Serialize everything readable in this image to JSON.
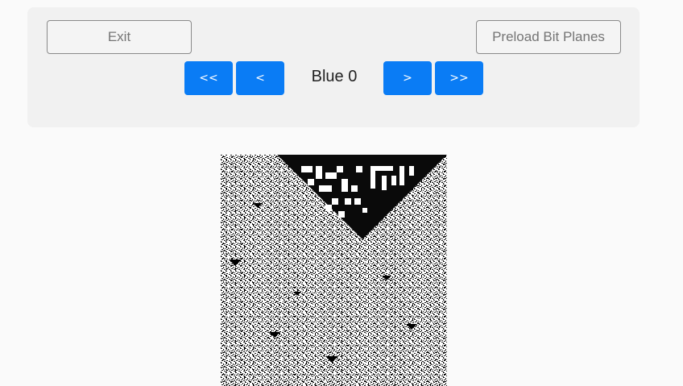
{
  "toolbar": {
    "exit_label": "Exit",
    "preload_label": "Preload Bit Planes",
    "first_label": "<<",
    "prev_label": "<",
    "next_label": ">",
    "last_label": ">>",
    "current_plane": "Blue 0"
  },
  "colors": {
    "accent": "#0a7cf5",
    "panel": "#f1f1f1",
    "background": "#fafafa"
  }
}
